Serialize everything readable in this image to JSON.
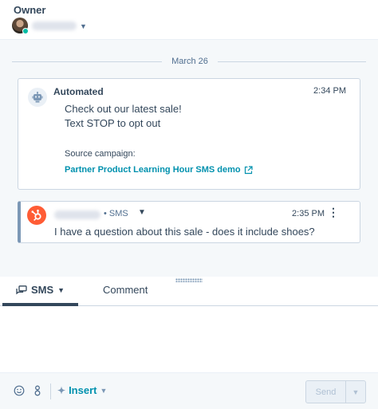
{
  "owner": {
    "label": "Owner"
  },
  "timeline": {
    "date_divider": "March 26"
  },
  "automated_message": {
    "title": "Automated",
    "time": "2:34 PM",
    "lines": [
      "Check out our latest sale!",
      "Text STOP to opt out"
    ],
    "source_label": "Source campaign:",
    "campaign_link": "Partner Product Learning Hour SMS demo"
  },
  "incoming_sms": {
    "channel": "• SMS",
    "time": "2:35 PM",
    "text": "I have a question about this sale - does it include shoes?"
  },
  "composer": {
    "tabs": [
      {
        "label": "SMS",
        "active": true
      },
      {
        "label": "Comment",
        "active": false
      }
    ],
    "insert_label": "Insert",
    "send_label": "Send"
  },
  "colors": {
    "accent": "#0091ae",
    "text": "#33475b",
    "hubspot_orange": "#ff5c35",
    "online": "#00bda5"
  },
  "icons": [
    "robot-icon",
    "external-link-icon",
    "hubspot-sprocket-icon",
    "kebab-menu-icon",
    "sms-chat-icon",
    "emoji-icon",
    "snippet-icon",
    "sparkle-icon",
    "chevron-down-icon"
  ]
}
